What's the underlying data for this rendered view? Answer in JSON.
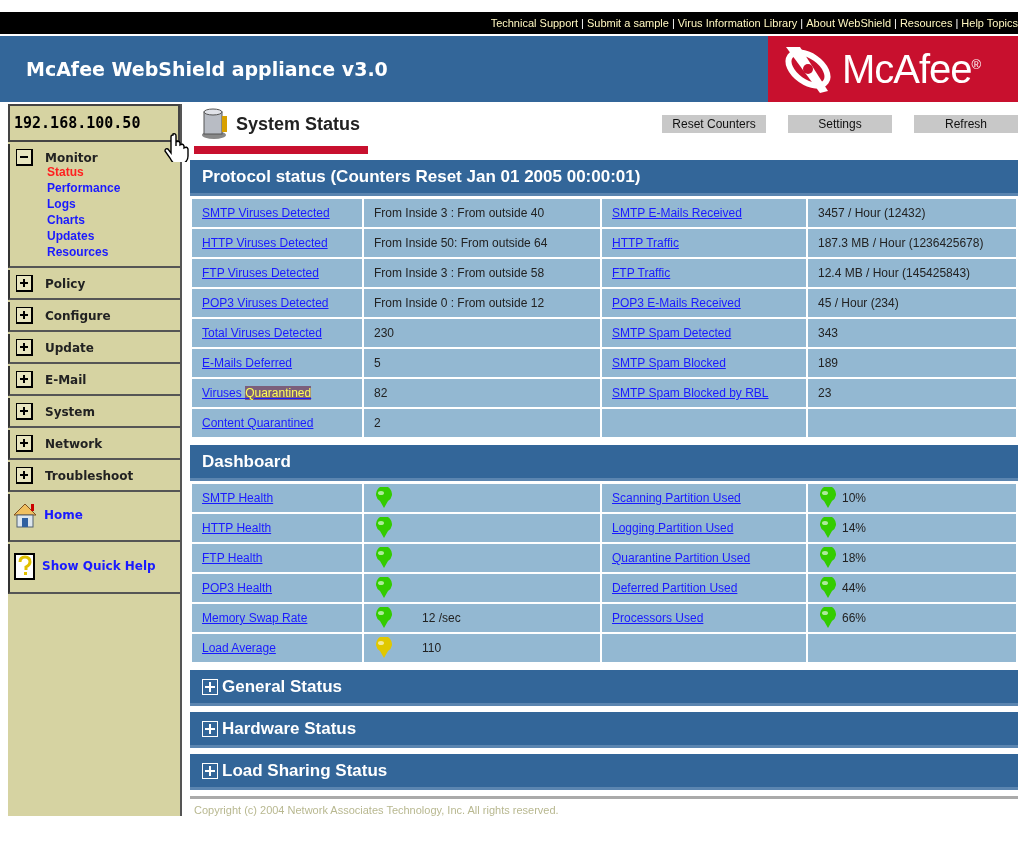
{
  "top_links": {
    "separator": "|",
    "links": [
      "Technical Support",
      "Submit a sample",
      "Virus Information Library",
      "About WebShield",
      "Resources",
      "Help Topics"
    ]
  },
  "header": {
    "title": "McAfee WebShield appliance v3.0",
    "logo_text": "McAfee$^{®}$"
  },
  "sidebar": {
    "address": "192.168.100.50",
    "groups": [
      {
        "label": "Monitor",
        "expanded": true,
        "children": [
          {
            "label": "Status",
            "selected": true
          },
          {
            "label": "Performance",
            "selected": false
          },
          {
            "label": "Logs",
            "selected": false
          },
          {
            "label": "Charts",
            "selected": false
          },
          {
            "label": "Updates",
            "selected": false
          },
          {
            "label": "Resources",
            "selected": false
          }
        ]
      },
      {
        "label": "Policy",
        "expanded": false
      },
      {
        "label": "Configure",
        "expanded": false
      },
      {
        "label": "Update",
        "expanded": false
      },
      {
        "label": "E-Mail",
        "expanded": false
      },
      {
        "label": "System",
        "expanded": false
      },
      {
        "label": "Network",
        "expanded": false
      },
      {
        "label": "Troubleshoot",
        "expanded": false
      }
    ],
    "links": [
      {
        "kind": "home",
        "label": "Home"
      },
      {
        "kind": "help",
        "label": "Show Quick Help"
      }
    ]
  },
  "page": {
    "title": "System Status",
    "buttons": [
      "Reset Counters",
      "Settings",
      "Refresh"
    ]
  },
  "protocol_status": {
    "title": "Protocol status (Counters Reset Jan 01 2005 00:00:01)",
    "rows": [
      [
        {
          "label": [
            {
              "text": "SMTP Viruses Detected",
              "highlighted": false
            }
          ],
          "value": "From Inside 3 : From outside 40"
        },
        {
          "label": [
            {
              "text": "SMTP E-Mails Received",
              "highlighted": false
            }
          ],
          "value": "3457 / Hour (12432)"
        }
      ],
      [
        {
          "label": [
            {
              "text": "HTTP Viruses Detected",
              "highlighted": false
            }
          ],
          "value": "From Inside 50: From outside 64"
        },
        {
          "label": [
            {
              "text": "HTTP Traffic",
              "highlighted": false
            }
          ],
          "value": "187.3 MB / Hour (1236425678)"
        }
      ],
      [
        {
          "label": [
            {
              "text": "FTP Viruses Detected",
              "highlighted": false
            }
          ],
          "value": "From Inside 3 : From outside 58"
        },
        {
          "label": [
            {
              "text": "FTP Traffic",
              "highlighted": false
            }
          ],
          "value": "12.4 MB / Hour (145425843)"
        }
      ],
      [
        {
          "label": [
            {
              "text": "POP3 Viruses Detected",
              "highlighted": false
            }
          ],
          "value": "From Inside 0 : From outside 12"
        },
        {
          "label": [
            {
              "text": "POP3 E-Mails Received",
              "highlighted": false
            }
          ],
          "value": "45 / Hour (234)"
        }
      ],
      [
        {
          "label": [
            {
              "text": "Total Viruses Detected",
              "highlighted": false
            }
          ],
          "value": "230"
        },
        {
          "label": [
            {
              "text": "SMTP Spam Detected",
              "highlighted": false
            }
          ],
          "value": "343"
        }
      ],
      [
        {
          "label": [
            {
              "text": "E-Mails Deferred",
              "highlighted": false
            }
          ],
          "value": "5"
        },
        {
          "label": [
            {
              "text": "SMTP Spam Blocked",
              "highlighted": false
            }
          ],
          "value": "189"
        }
      ],
      [
        {
          "label": [
            {
              "text": "Viruses ",
              "highlighted": false
            },
            {
              "text": "Quarantined",
              "highlighted": true
            }
          ],
          "value": "82"
        },
        {
          "label": [
            {
              "text": "SMTP Spam Blocked by RBL",
              "highlighted": false
            }
          ],
          "value": "23"
        }
      ],
      [
        {
          "label": [
            {
              "text": "Content Quarantined",
              "highlighted": false
            }
          ],
          "value": "2"
        },
        null
      ]
    ]
  },
  "dashboard": {
    "title": "Dashboard",
    "rows": [
      [
        {
          "label": "SMTP Health",
          "color": "#33cc00"
        },
        {
          "label": "Scanning Partition Used",
          "color": "#33cc00",
          "value": "10%"
        }
      ],
      [
        {
          "label": "HTTP Health",
          "color": "#33cc00"
        },
        {
          "label": "Logging Partition Used",
          "color": "#33cc00",
          "value": "14%"
        }
      ],
      [
        {
          "label": "FTP Health",
          "color": "#33cc00"
        },
        {
          "label": "Quarantine Partition Used",
          "color": "#33cc00",
          "value": "18%"
        }
      ],
      [
        {
          "label": "POP3 Health",
          "color": "#33cc00"
        },
        {
          "label": "Deferred Partition Used",
          "color": "#33cc00",
          "value": "44%"
        }
      ],
      [
        {
          "label": "Memory Swap Rate",
          "color": "#33cc00",
          "value": "12 /sec"
        },
        {
          "label": "Processors Used",
          "color": "#33cc00",
          "value": "66%"
        }
      ],
      [
        {
          "label": "Load Average",
          "color": "#e0c800",
          "value": "110"
        },
        null
      ]
    ]
  },
  "collapsed_sections": [
    {
      "title": "General Status",
      "expanded": false
    },
    {
      "title": "Hardware Status",
      "expanded": false
    },
    {
      "title": "Load Sharing Status",
      "expanded": false
    }
  ],
  "footer": "Copyright (c) 2004 Network Associates Technology, Inc. All rights reserved."
}
